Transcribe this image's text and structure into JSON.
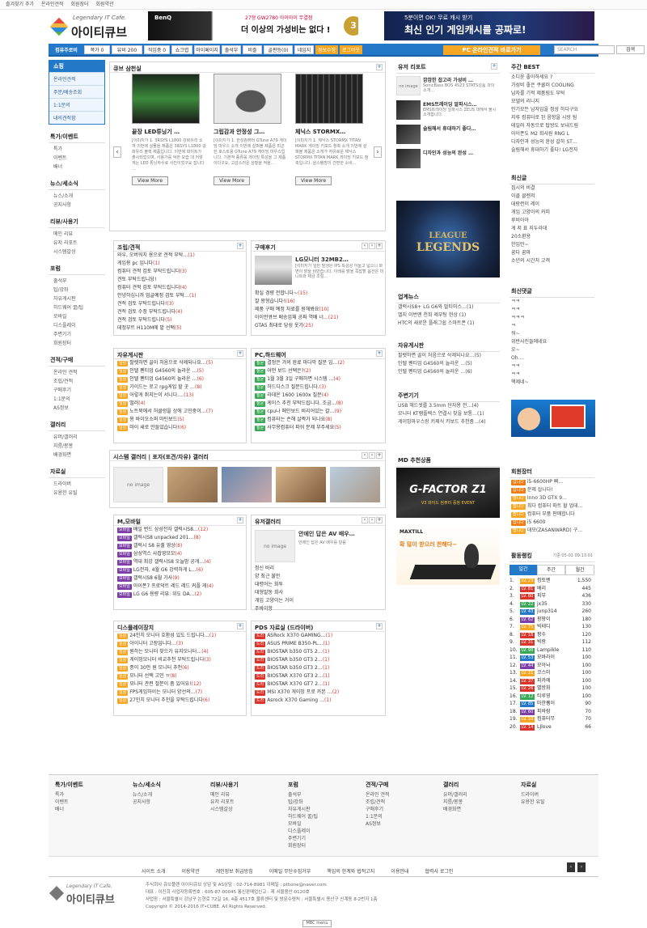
{
  "top_links": [
    "즐겨찾기 추가",
    "온라인견적",
    "회원장터",
    "회원약관"
  ],
  "logo": {
    "tagline": "Legendary IT Cafe.",
    "name": "아이티큐브"
  },
  "banner1": {
    "brand": "BenQ",
    "line1": "27형 GW2780 아이아이 무결점",
    "line2": "더 이상의 가성비는 없다 !",
    "badge": "3"
  },
  "banner2": {
    "line1": "5분이면 OK! 무료 캐시 받기",
    "line2": "최신 인기 게임캐시를 공짜로!"
  },
  "nav": {
    "items": [
      "컴퓨주로비",
      "쪽가 0",
      "뷰비 200",
      "직임중 0",
      "쇼크렵",
      "마이페이지",
      "출석부",
      "비즐",
      "골판등(0)",
      "네임지",
      "정보수정",
      "로그아웃"
    ],
    "pc_button": "PC 온라인견적 바로가기",
    "search_placeholder": "SEARCH",
    "search_button": "검색"
  },
  "left": {
    "shop_title": "쇼핑",
    "shop_items": [
      "온라인견적",
      "주문/배송조회",
      "1:1문의",
      "내의견적함"
    ],
    "sections": [
      {
        "title": "특가/이벤트",
        "items": [
          "특가",
          "이벤트",
          "배너"
        ]
      },
      {
        "title": "뉴스/세소식",
        "items": [
          "뉴스/소개",
          "공지사항"
        ]
      },
      {
        "title": "리뷰/사용기",
        "items": [
          "메인 리뷰",
          "유저 리포트",
          "시스템갈상"
        ]
      },
      {
        "title": "포럼",
        "items": [
          "출석부",
          "팁/강좌",
          "자유게시판",
          "하드웨어 꿀/팁",
          "모바일",
          "디스플레이",
          "주변기기",
          "회원장터"
        ]
      },
      {
        "title": "견적/구매",
        "items": [
          "온라인 견적",
          "조립/견적",
          "구매후기",
          "1:1문의",
          "AS정보"
        ]
      },
      {
        "title": "갤러리",
        "items": [
          "유머/갤러리",
          "지름/봉봉",
          "배경화면"
        ]
      },
      {
        "title": "자료실",
        "items": [
          "드라이버",
          "유용한 유틸"
        ]
      }
    ]
  },
  "cube_recommend": {
    "title": "큐브 삼천실",
    "products": [
      {
        "name": "끝장 LED튜닝기 …",
        "desc": "[이미지가 1. 3RSYS L1800 강화유리 소개 이번에 실물을 제품은 3RSYS L1800 강화유리 블랙 제품입니다. 이번에 화이트가 출시되었으며, 사용가를 억한 모습 대 어렇게는 LED 튜닝하수로 사진이었구요 잡니다 …",
        "btn": "View More"
      },
      {
        "name": "그립감과 안정성 그…",
        "desc": "[이미지가 1. 한성컴퓨터 GTune A79 게이밍 마우스 소개 이번에 살펴볼 제품은 피곤한 호스트용 GTune A79 게이밍 마우스입니다. 기본적 종류를 게이밍 특성을 그 제품이다구요, 고감스러운 상황을 적을…",
        "btn": "View More"
      },
      {
        "name": "체닉스 STORMX…",
        "desc": "[이미지가 1. 체닉스 STORMX TITAN MARK 게이밍 키보드 청축 소개 이번에 살펴볼 제품은 소개가 자유로운 체닉스 STORMX TITAN MARK 게이밍 키보드 청축입니다. 원스템방이 간편한 소비…",
        "btn": "View More"
      }
    ]
  },
  "assembly": {
    "title": "조립/견적",
    "items": [
      {
        "t": "와우, 오버워치 용으로 견적 부탁…",
        "c": "(1)"
      },
      {
        "t": "게임용 pc 입니다",
        "c": "(1)"
      },
      {
        "t": "컴퓨터 견적 검토 부탁드립니다",
        "c": "(3)"
      },
      {
        "t": "견토 부탁드립니당!",
        "c": ""
      },
      {
        "t": "컴퓨터 견적 검토 부탁드립니다",
        "c": "(4)"
      },
      {
        "t": "안녕하십니까 업글예정 검토 부탁…",
        "c": "(1)"
      },
      {
        "t": "견적 검토 부탁드립니다!",
        "c": "(3)"
      },
      {
        "t": "견적 검토 수정 부탁드립니다",
        "c": "(4)"
      },
      {
        "t": "견적 검토 부탁드립니다",
        "c": "(5)"
      },
      {
        "t": "데정부트 H110M에 맡 선택",
        "c": "(5)"
      }
    ]
  },
  "purchase_review": {
    "title": "구매후기",
    "featured_title": "LG모니터 32MB2…",
    "featured_desc": "[이미지가 일반 발생은 IPS 특성상 어둡고 넓으니 화면이 밝을 비만습니다. 아래를 밝을 쪽잡할 옵션은 마니트와 제금 조절…",
    "items": [
      {
        "t": "확실 경량 전합니다~",
        "c": "(15)"
      },
      {
        "t": "잘 왕형습니다!",
        "c": "(16)"
      },
      {
        "t": "제품 구매 예정 자료를 원해봐요",
        "c": "(10)"
      },
      {
        "t": "아이언큐브 배송업체 공짜 역배 너…",
        "c": "(21)"
      },
      {
        "t": "GTA5 최대로 당성 옷가",
        "c": "(25)"
      }
    ]
  },
  "free_board": {
    "title": "자유게시판",
    "items": [
      {
        "tag": "일상",
        "t": "팔렛하면 골이 처음으로 삭제되나요…",
        "c": "(5)"
      },
      {
        "tag": "일상",
        "t": "인텔 펜티엄 G4560의 놀라운 …",
        "c": "(5)"
      },
      {
        "tag": "일상",
        "t": "인텔 펜티엄 G4560의 놀라운 …",
        "c": "(6)"
      },
      {
        "tag": "일상",
        "t": "가이드는 로고 rpg게임 할 곳 …",
        "c": "(8)"
      },
      {
        "tag": "일상",
        "t": "어렇게 취지는이 서니다.…",
        "c": "(13)"
      },
      {
        "tag": "일상",
        "t": "떨러",
        "c": "(4)"
      },
      {
        "tag": "일상",
        "t": "노트북에서 허클렁을 상에 고민중이…",
        "c": "(7)"
      },
      {
        "tag": "일상",
        "t": "용 바이오소퍼 마틴보드",
        "c": "(5)"
      },
      {
        "tag": "일상",
        "t": "마이 새로 만들었습니다!",
        "c": "(6)"
      }
    ]
  },
  "pc_hardware": {
    "title": "PC,하드웨어",
    "items": [
      {
        "tag": "질문",
        "t": "결정은 겨의 완료 마다막 질문 입…",
        "c": "(2)"
      },
      {
        "tag": "질문",
        "t": "어떤 보드 선택은?",
        "c": "(2)"
      },
      {
        "tag": "질문",
        "t": "1월 3월 3일 구매하면 시스템 …",
        "c": "(4)"
      },
      {
        "tag": "질문",
        "t": "하드디스크 질문드립니다.",
        "c": "(3)"
      },
      {
        "tag": "질문",
        "t": "라데온 1600 1600x 질문",
        "c": "(4)"
      },
      {
        "tag": "질문",
        "t": "케이스 추천 부탁드립니다. 조금…",
        "c": "(8)"
      },
      {
        "tag": "질문",
        "t": "cpu나 메인보드 비리어있는 갈…",
        "c": "(9)"
      },
      {
        "tag": "질문",
        "t": "컴퓨터는 손해 살짝가 되나요",
        "c": "(8)"
      },
      {
        "tag": "질문",
        "t": "사무용컴퓨터 파워 문제 부주세요",
        "c": "(5)"
      }
    ]
  },
  "system_gallery": {
    "title": "시스템 갤러리 | 포자(포견/자유) 갤러리",
    "noimage": "no image"
  },
  "mobile": {
    "title": "M,모바일",
    "items": [
      {
        "tag": "모바일",
        "t": "배일 번드 삼성전자 갤럭시S8…",
        "c": "(12)"
      },
      {
        "tag": "모바일",
        "t": "갤럭시S8 unpacked 201…",
        "c": "(8)"
      },
      {
        "tag": "모바일",
        "t": "갤럭시 S8 유출 영상",
        "c": "(8)"
      },
      {
        "tag": "모바일",
        "t": "삼성역스 샤잡영모모",
        "c": "(4)"
      },
      {
        "tag": "모바일",
        "t": "역대 최강 갤럭시S8 오늘밤 공개…",
        "c": "(4)"
      },
      {
        "tag": "모바일",
        "t": "LG전자, 4월 G6 강력하게 L…",
        "c": "(6)"
      },
      {
        "tag": "모바일",
        "t": "갤럭시S8 6월 가사",
        "c": "(9)"
      },
      {
        "tag": "모바일",
        "t": "아이폰7 프로덕트 레드 레드 커플 게",
        "c": "(4)"
      },
      {
        "tag": "모바일",
        "t": "LG G6 용량 리뷰: 위도 DA…",
        "c": "(2)"
      }
    ]
  },
  "user_gallery": {
    "title": "유저갤러리",
    "noimage": "no image",
    "featured_title": "안에인 답은 AV 배우…",
    "featured_desc": "안에인 답은 AV 배우를 알음",
    "items": [
      "정신 바리",
      "양 최근 불안",
      "대령어는 화투",
      "대형발동 회사",
      "개임 고양이는 거이",
      "주바이항"
    ]
  },
  "display": {
    "title": "디스플레이장치",
    "items": [
      {
        "tag": "일상",
        "t": "24인치 모니터 호환성 있도 드립니다…",
        "c": "(1)"
      },
      {
        "tag": "일상",
        "t": "아이니터 고장입니다…",
        "c": "(3)"
      },
      {
        "tag": "일상",
        "t": "원하는 모니터 찾으가 유지모니터…",
        "c": "(4)"
      },
      {
        "tag": "일상",
        "t": "게이밍모니터 비교추천 부탁드립니다",
        "c": "(3)"
      },
      {
        "tag": "일상",
        "t": "종이 30만 원 모니터 추천",
        "c": "(6)"
      },
      {
        "tag": "일상",
        "t": "모니터 선택 고민 ㅠ",
        "c": "(8)"
      },
      {
        "tag": "일상",
        "t": "모니터 관련 절문이 좀 있어요!",
        "c": "(12)"
      },
      {
        "tag": "일상",
        "t": "FPS게임하이는 모니터 양선의…",
        "c": "(7)"
      },
      {
        "tag": "일상",
        "t": "27인치 모니터 추천을 부탁드립니다",
        "c": "(6)"
      }
    ]
  },
  "pds": {
    "title": "PDS 자료실 (드라이버)",
    "items": [
      {
        "tag": "드라",
        "t": "ASRock X370 GAMING…",
        "c": "(1)"
      },
      {
        "tag": "드라",
        "t": "ASUS PRIME B350-PL…",
        "c": "(1)"
      },
      {
        "tag": "드라",
        "t": "BIOSTAR b350 GT5 2…",
        "c": "(1)"
      },
      {
        "tag": "드라",
        "t": "BIOSTAR b350 GT3 2…",
        "c": "(1)"
      },
      {
        "tag": "드라",
        "t": "BIOSTAR b350 GT3 2…",
        "c": "(1)"
      },
      {
        "tag": "드라",
        "t": "BIOSTAR X370 GT3 2…",
        "c": "(1)"
      },
      {
        "tag": "드라",
        "t": "BIOSTAR X370 GT7 2…",
        "c": "(1)"
      },
      {
        "tag": "드라",
        "t": "MSI X370 게이밍 프로 카본 …",
        "c": "(2)"
      },
      {
        "tag": "드라",
        "t": "Asrock X370 Gaming …",
        "c": "(1)"
      }
    ]
  },
  "user_report": {
    "title": "유저 리포트",
    "noimage": "no image",
    "items": [
      {
        "t": "깜깜한 잡고라 가성비 …",
        "d": "SonicBass BOS 4S23 STATS성품 과의 소개…"
      },
      {
        "t": "EMS트레이딩 알파시스…",
        "d": "EMS트레이딩 알파시스 ZEUS 대해서 불시 소개합니다."
      },
      {
        "t": "슬림해서 휴대하기 좋다…",
        "d": ""
      },
      {
        "t": "디자인과 성능의 완성 …",
        "d": ""
      }
    ]
  },
  "lol_banner": {
    "line1": "LEAGUE",
    "line2": "LEGENDS"
  },
  "industry_news": {
    "title": "업계뉴스",
    "items": [
      "갤럭시S8+ LG G6와 멀티미스…(1)",
      "엘지 이번엔 천희 제부팅 현상 (1)",
      "HTC의 새로운 플래그쉽 스마트폰 (1)"
    ]
  },
  "free_board2": {
    "title": "자유게시판",
    "items": [
      "팔렛하면 골이 처음으로 삭제되나요…(5)",
      "인텔 펜티엄 G4560의 놀라운 …(5)",
      "인텔 펜티엄 G4560의 놀라운 …(6)"
    ]
  },
  "peripheral": {
    "title": "주변기기",
    "items": [
      "USB 헤드셋를 3.5mm 단자용 전…(4)",
      "모니터 KT램플렉스 연결시 찾을 보통…(1)",
      "게이밍마우스랑 키제식 키보드 추천좀…(4)"
    ]
  },
  "md_pick": {
    "title": "MD 추천상품",
    "banner1": "G-FACTOR Z1",
    "banner1_sub": "V3 와이드 컴퓨터 증정 EVENT",
    "banner2_brand": "MAXTILL",
    "banner2_text": "확 많이 받으러 한해다~"
  },
  "weekly_best": {
    "title": "주간 BEST",
    "items": [
      "소디윤 좋아하세요 ?",
      "가성비 좋은 쿠쿨러 COOLING",
      "남자를 기적 제품림도 부탁",
      "모델의 리니지",
      "인기모든 남자임을 정상 하다구요",
      "지루 컴퓨터로 된 음향을 시방 됨",
      "테일러 자동으로 탑방도 보내드림",
      "아이폰도 M2 회사원 RNG L",
      "디자인과 성능의 완성 갈하 ST…",
      "슬림해서 휴대하기 좋다! LG전자"
    ]
  },
  "latest": {
    "title": "최신글",
    "items": [
      "집시의 비결",
      "이클 클렌저",
      "데랑런이 레이",
      "게임 고양이의 커피",
      "루비아아",
      "게 저 표 지두라데",
      "20소환용",
      "한입만~",
      "꿈다 꿈마",
      "소년의 시간처 고객"
    ]
  },
  "latest_comments": {
    "title": "최신댓글",
    "items": [
      "ㅋㅋ",
      "ㅋㅋ",
      "ㅋㅋㅋ",
      "ㅋ",
      "워~",
      "위반사진들에네요",
      "오~",
      "Oh....",
      "ㅋㅋ",
      "ㅋㅋ",
      "핵제네~"
    ]
  },
  "market": {
    "title": "회원장터",
    "items": [
      {
        "tag": "삽니다",
        "t": "i5-6600HP 삐…"
      },
      {
        "tag": "삽니다",
        "t": "문제 삽니다!"
      },
      {
        "tag": "팝니다",
        "t": "Inno 3D GTX 9…"
      },
      {
        "tag": "팝니다",
        "t": "최다 컴퓨터 파트 할 업데…"
      },
      {
        "tag": "팝니다",
        "t": "컴퓨터 부품 판매합니다"
      },
      {
        "tag": "삽니다",
        "t": "i5 6600"
      },
      {
        "tag": "팝니다",
        "t": "데모(ZASANWARD) 구…"
      }
    ]
  },
  "activity_rank": {
    "title": "활동랭킹",
    "date": "기준 05-01 09:13:01",
    "tabs": [
      "일간",
      "주간",
      "월간"
    ],
    "rows": [
      {
        "n": "1.",
        "lv": "LV. 23",
        "name": "컴토벤",
        "score": "1,550"
      },
      {
        "n": "2.",
        "lv": "LV. 81",
        "name": "베리",
        "score": "445"
      },
      {
        "n": "3.",
        "lv": "LV. 80",
        "name": "피부",
        "score": "436"
      },
      {
        "n": "4.",
        "lv": "LV. 22",
        "name": "jx35",
        "score": "330"
      },
      {
        "n": "5.",
        "lv": "LV. 43",
        "name": "junp314",
        "score": "260"
      },
      {
        "n": "6.",
        "lv": "LV. 62",
        "name": "팡팡이",
        "score": "180"
      },
      {
        "n": "7.",
        "lv": "LV. 75",
        "name": "빅테디",
        "score": "130"
      },
      {
        "n": "8.",
        "lv": "LV. 18",
        "name": "팡수",
        "score": "120"
      },
      {
        "n": "9.",
        "lv": "LV. 31",
        "name": "빅랑",
        "score": "112"
      },
      {
        "n": "10.",
        "lv": "LV. 98",
        "name": "Lampikle",
        "score": "110"
      },
      {
        "n": "11.",
        "lv": "LV. 53",
        "name": "모바라이",
        "score": "100"
      },
      {
        "n": "12.",
        "lv": "LV. 44",
        "name": "모아놔",
        "score": "100"
      },
      {
        "n": "13.",
        "lv": "LV. 21",
        "name": "코스미",
        "score": "100"
      },
      {
        "n": "14.",
        "lv": "LV. 37",
        "name": "파카에",
        "score": "100"
      },
      {
        "n": "15.",
        "lv": "LV. 26",
        "name": "별방화",
        "score": "100"
      },
      {
        "n": "16.",
        "lv": "LV. 12",
        "name": "티루영",
        "score": "100"
      },
      {
        "n": "17.",
        "lv": "LV. 85",
        "name": "마한퀭이",
        "score": "90"
      },
      {
        "n": "18.",
        "lv": "LV. 60",
        "name": "피바람",
        "score": "70"
      },
      {
        "n": "19.",
        "lv": "LV. 10",
        "name": "컴퓨터무",
        "score": "70"
      },
      {
        "n": "20.",
        "lv": "LV. 14",
        "name": "LJlove",
        "score": "66"
      }
    ]
  },
  "footer_nav": [
    {
      "title": "특가/이벤트",
      "items": [
        "특가",
        "이벤트",
        "배너"
      ]
    },
    {
      "title": "뉴스/세소식",
      "items": [
        "뉴스/소개",
        "공지사항"
      ]
    },
    {
      "title": "리뷰/사용기",
      "items": [
        "메인 리뷰",
        "유저 리포트",
        "시스템갈상"
      ]
    },
    {
      "title": "포럼",
      "items": [
        "출석부",
        "팁/강좌",
        "자유게시판",
        "하드웨어 꿀/팁",
        "모바일",
        "디스플레이",
        "주변기기",
        "회원장터"
      ]
    },
    {
      "title": "견적/구매",
      "items": [
        "온라인 견적",
        "조립/견적",
        "구매후기",
        "1:1문의",
        "AS정보"
      ]
    },
    {
      "title": "갤러리",
      "items": [
        "유머/갤러리",
        "지름/봉봉",
        "배경화면"
      ]
    },
    {
      "title": "자료실",
      "items": [
        "드라이버",
        "유용한 유틸"
      ]
    }
  ],
  "footer_links": [
    "사이트 소개",
    "이용약관",
    "개인정보 취급방침",
    "이메일 무단수집거부",
    "책임의 한계와 법적고지",
    "이용안내",
    "협력사 로그인"
  ],
  "footer_info": [
    "주식회사 큐브플랜 아이티큐브   상담 및 AS상담 : 02-714-8981   이메일 : pthone@naver.com",
    "대표 : 이진희   사업자등록번호 : 605-87-00045   통신판매업신고 : 제 서울용산-0120호",
    "사업장 : 서울특별시 강남구 논현로 72길 16, 4층 4517호   물류센터 및 방문수령처 : 서울특별시 용산구 신계동 8-2번지 1층",
    "Copyright © 2014-2016 IT•CUBE. All Rights Reserved."
  ],
  "mbc": "MBC menu"
}
